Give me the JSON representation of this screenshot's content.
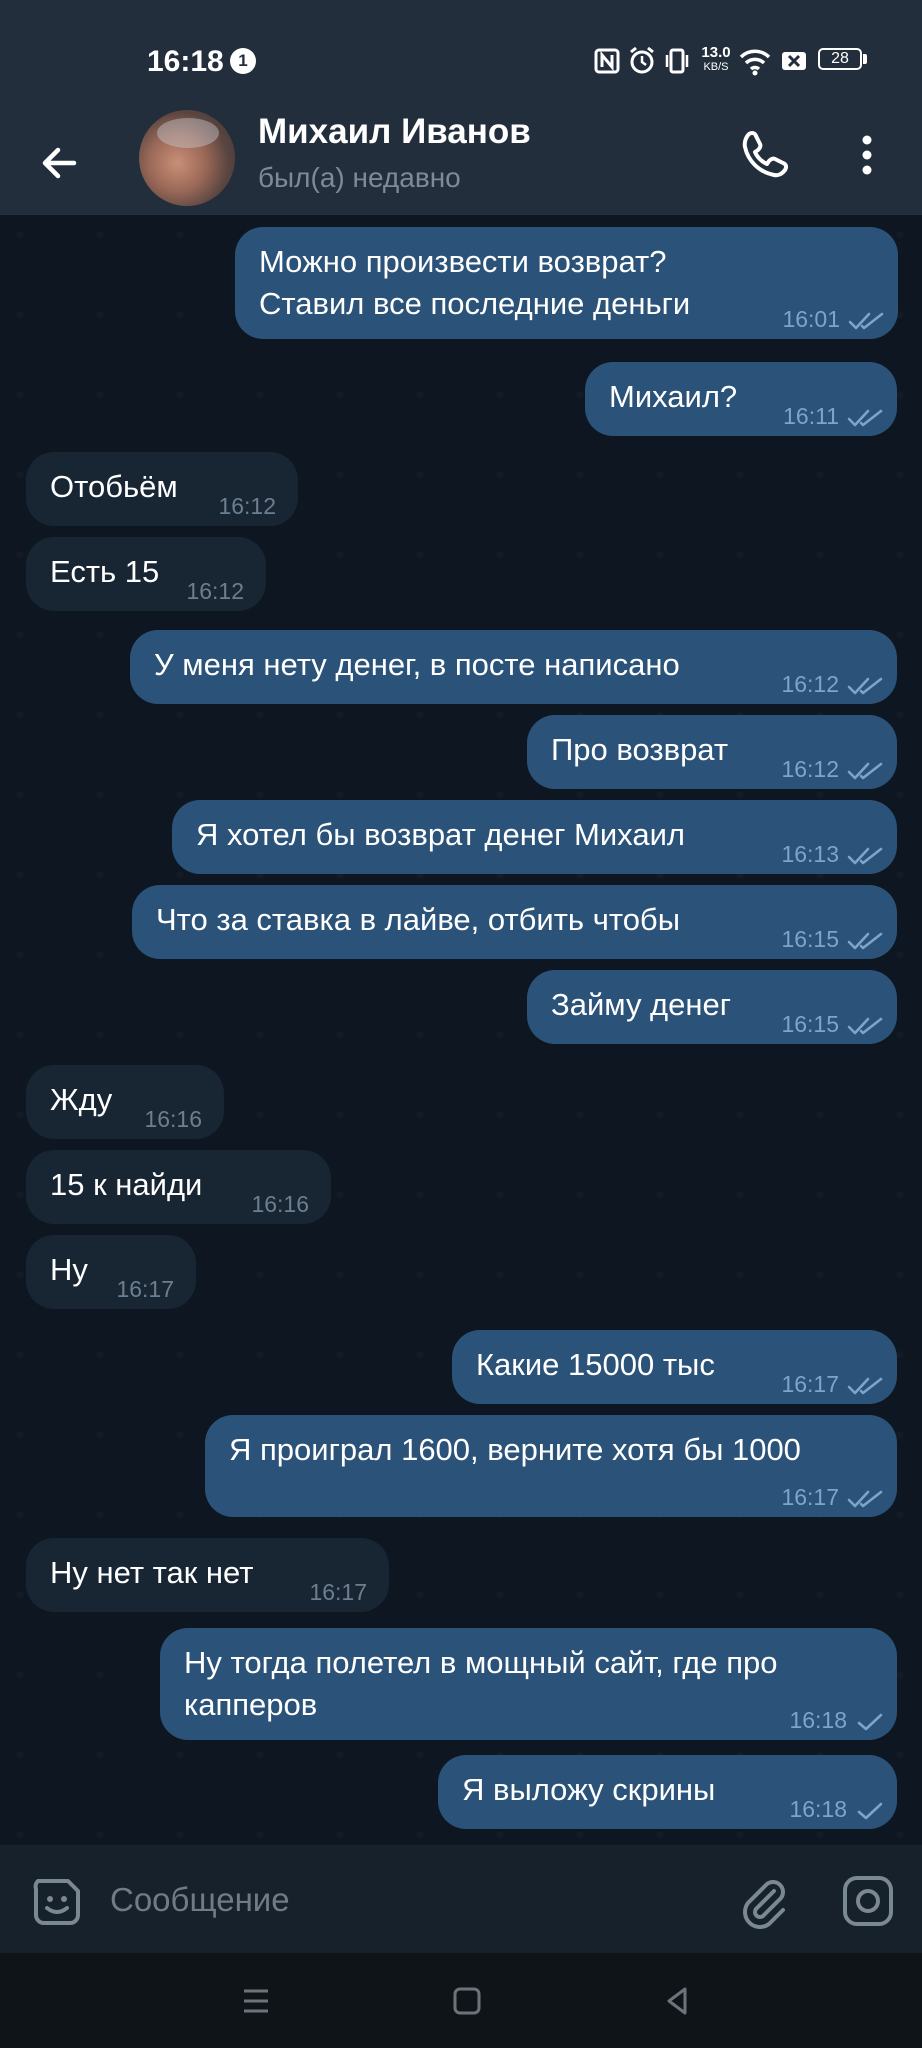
{
  "status_bar": {
    "time": "16:18",
    "notification_count": "1",
    "net_speed_value": "13.0",
    "net_speed_unit": "KB/S",
    "battery": "28"
  },
  "header": {
    "name": "Михаил Иванов",
    "status": "был(а) недавно"
  },
  "messages": [
    {
      "dir": "out",
      "text": "Можно произвести возврат?\nСтавил все последние деньги",
      "time": "16:01",
      "read": true
    },
    {
      "dir": "out",
      "text": "Михаил?",
      "time": "16:11",
      "read": true
    },
    {
      "dir": "in",
      "text": "Отобьём",
      "time": "16:12"
    },
    {
      "dir": "in",
      "text": "Есть 15",
      "time": "16:12"
    },
    {
      "dir": "out",
      "text": "У меня нету денег, в посте написано",
      "time": "16:12",
      "read": true
    },
    {
      "dir": "out",
      "text": "Про возврат",
      "time": "16:12",
      "read": true
    },
    {
      "dir": "out",
      "text": "Я хотел бы возврат денег Михаил",
      "time": "16:13",
      "read": true
    },
    {
      "dir": "out",
      "text": "Что за ставка в лайве, отбить чтобы",
      "time": "16:15",
      "read": true
    },
    {
      "dir": "out",
      "text": "Займу денег",
      "time": "16:15",
      "read": true
    },
    {
      "dir": "in",
      "text": "Жду",
      "time": "16:16"
    },
    {
      "dir": "in",
      "text": "15 к найди",
      "time": "16:16"
    },
    {
      "dir": "in",
      "text": "Ну",
      "time": "16:17"
    },
    {
      "dir": "out",
      "text": "Какие 15000 тыс",
      "time": "16:17",
      "read": true
    },
    {
      "dir": "out",
      "text": "Я проиграл 1600, верните хотя бы 1000",
      "time": "16:17",
      "read": true
    },
    {
      "dir": "in",
      "text": "Ну нет так нет",
      "time": "16:17"
    },
    {
      "dir": "out",
      "text": "Ну тогда полетел в мощный сайт, где про\nкапперов",
      "time": "16:18",
      "read": false
    },
    {
      "dir": "out",
      "text": "Я выложу скрины",
      "time": "16:18",
      "read": false
    }
  ],
  "input": {
    "placeholder": "Сообщение"
  },
  "colors": {
    "background": "#0e1621",
    "header": "#232e3c",
    "outgoing_bubble": "#2b5278",
    "incoming_bubble": "#182533",
    "outgoing_meta": "#7da5cc"
  },
  "icons": [
    "back-arrow-icon",
    "phone-icon",
    "more-vert-icon",
    "sticker-icon",
    "paperclip-icon",
    "camera-icon",
    "nfc-icon",
    "alarm-icon",
    "vibrate-icon",
    "wifi-icon",
    "close-box-icon",
    "battery-icon",
    "nav-menu-icon",
    "nav-home-icon",
    "nav-back-icon"
  ]
}
